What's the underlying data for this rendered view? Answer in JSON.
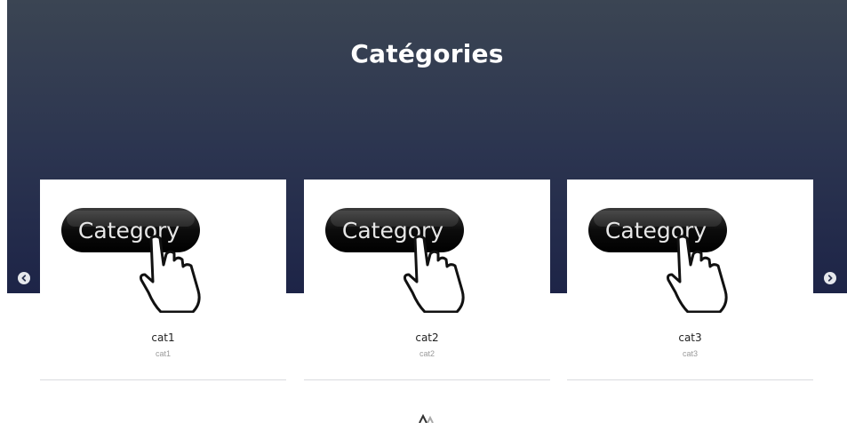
{
  "section": {
    "title": "Catégories"
  },
  "carousel": {
    "prev_icon": "chevron-left-icon",
    "next_icon": "chevron-right-icon",
    "cards": [
      {
        "image_text": "Category",
        "name": "cat1",
        "subtitle": "cat1"
      },
      {
        "image_text": "Category",
        "name": "cat2",
        "subtitle": "cat2"
      },
      {
        "image_text": "Category",
        "name": "cat3",
        "subtitle": "cat3"
      }
    ]
  },
  "colors": {
    "hero_top": "#3b4553",
    "hero_bottom": "#1d2447",
    "title": "#ffffff"
  }
}
